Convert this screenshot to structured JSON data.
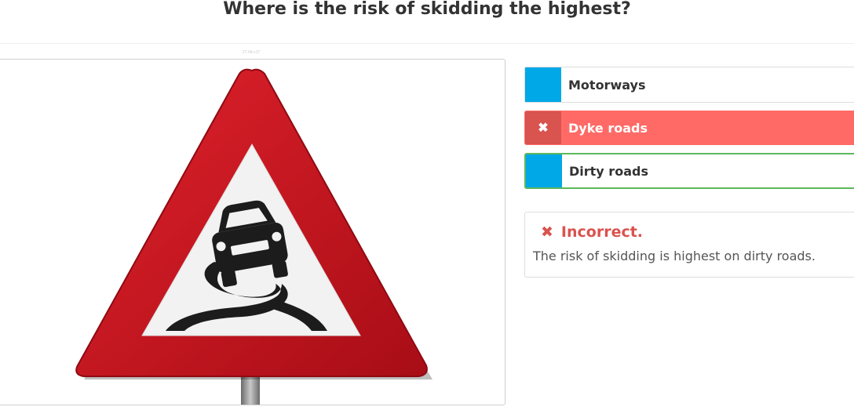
{
  "question": {
    "title": "Where is the risk of skidding the highest?"
  },
  "image": {
    "id_text": "27-04-c17"
  },
  "answers": [
    {
      "label": "Motorways",
      "state": "default",
      "marker": ""
    },
    {
      "label": "Dyke roads",
      "state": "wrong",
      "marker": "✖"
    },
    {
      "label": "Dirty roads",
      "state": "correct",
      "marker": ""
    }
  ],
  "feedback": {
    "icon": "✖",
    "title": "Incorrect.",
    "text": "The risk of skidding is highest on dirty roads."
  },
  "colors": {
    "answer_marker": "#00a8e8",
    "wrong_bg": "#ff6a66",
    "wrong_marker": "#d9534f",
    "correct_border": "#5cb85c",
    "sign_red": "#c8141e"
  }
}
